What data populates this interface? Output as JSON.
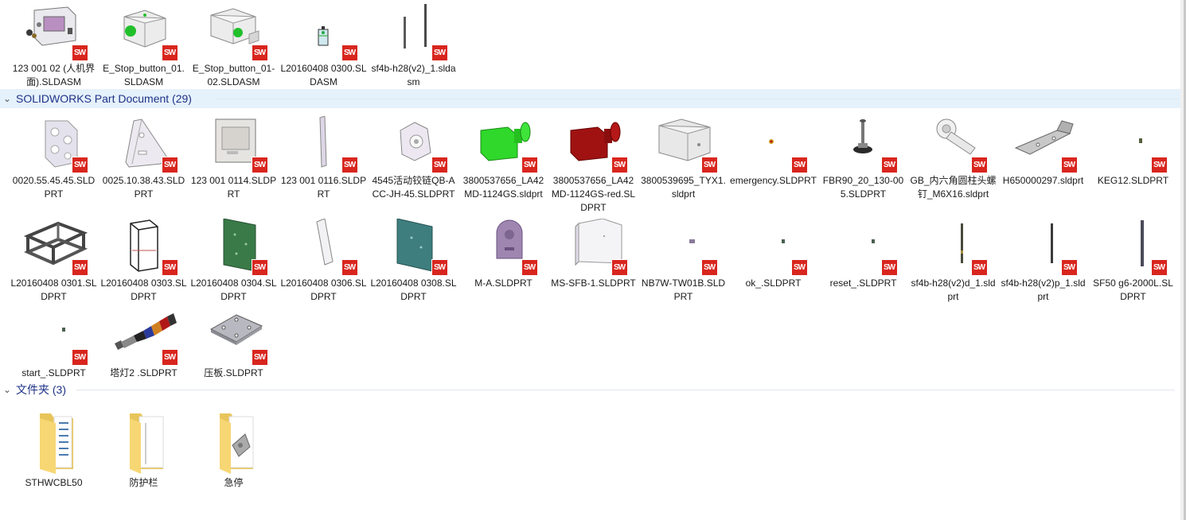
{
  "assemblies": [
    {
      "name": "123 001 02 (人机界面).SLDASM",
      "icon": "hmi-assembly-icon"
    },
    {
      "name": "E_Stop_button_01.SLDASM",
      "icon": "estop-assembly-icon"
    },
    {
      "name": "E_Stop_button_01-02.SLDASM",
      "icon": "estop-assembly-icon"
    },
    {
      "name": "L20160408 0300.SLDASM",
      "icon": "frame-assembly-icon"
    },
    {
      "name": "sf4b-h28(v2)_1.sldasm",
      "icon": "rods-assembly-icon"
    }
  ],
  "groups": {
    "parts_header": "SOLIDWORKS Part Document (29)",
    "folders_header": "文件夹 (3)"
  },
  "parts": [
    {
      "name": "0020.55.45.45.SLDPRT"
    },
    {
      "name": "0025.10.38.43.SLDPRT"
    },
    {
      "name": "123 001 0114.SLDPRT"
    },
    {
      "name": "123 001 0116.SLDPRT"
    },
    {
      "name": "4545活动铰链QB-ACC-JH-45.SLDPRT"
    },
    {
      "name": "3800537656_LA42MD-1124GS.sldprt"
    },
    {
      "name": "3800537656_LA42MD-1124GS-red.SLDPRT"
    },
    {
      "name": "3800539695_TYX1.sldprt"
    },
    {
      "name": "emergency.SLDPRT"
    },
    {
      "name": "FBR90_20_130-005.SLDPRT"
    },
    {
      "name": "GB_内六角圆柱头螺钉_M6X16.sldprt"
    },
    {
      "name": "H650000297.sldprt"
    },
    {
      "name": "KEG12.SLDPRT"
    },
    {
      "name": "L20160408 0301.SLDPRT"
    },
    {
      "name": "L20160408 0303.SLDPRT"
    },
    {
      "name": "L20160408 0304.SLDPRT"
    },
    {
      "name": "L20160408 0306.SLDPRT"
    },
    {
      "name": "L20160408 0308.SLDPRT"
    },
    {
      "name": "M-A.SLDPRT"
    },
    {
      "name": "MS-SFB-1.SLDPRT"
    },
    {
      "name": "NB7W-TW01B.SLDPRT"
    },
    {
      "name": "ok_.SLDPRT"
    },
    {
      "name": "reset_.SLDPRT"
    },
    {
      "name": "sf4b-h28(v2)d_1.sldprt"
    },
    {
      "name": "sf4b-h28(v2)p_1.sldprt"
    },
    {
      "name": "SF50 g6-2000L.SLDPRT"
    },
    {
      "name": "start_.SLDPRT"
    },
    {
      "name": "塔灯2 .SLDPRT"
    },
    {
      "name": "压板.SLDPRT"
    }
  ],
  "folders": [
    {
      "name": "STHWCBL50"
    },
    {
      "name": "防护栏"
    },
    {
      "name": "急停"
    }
  ],
  "badge_text": "SW",
  "colors": {
    "badge": "#d8261e",
    "group_text": "#1e3287",
    "selected_header_bg": "#e5f1fb",
    "folder": "#f7d774"
  }
}
